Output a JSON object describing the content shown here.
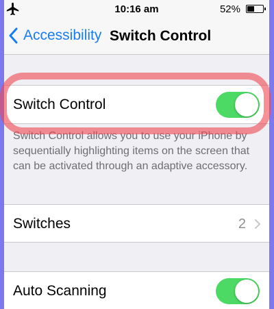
{
  "status_bar": {
    "airplane_icon": "airplane-icon",
    "time": "10:16 am",
    "battery_percent": "52%",
    "battery_level": 0.52
  },
  "nav": {
    "back_label": "Accessibility",
    "title": "Switch Control"
  },
  "switch_control": {
    "label": "Switch Control",
    "enabled": true,
    "footer": "Switch Control allows you to use your iPhone by sequentially highlighting items on the screen that can be activated through an adaptive accessory."
  },
  "switches": {
    "label": "Switches",
    "value": "2"
  },
  "auto_scanning": {
    "label": "Auto Scanning",
    "enabled": true
  },
  "colors": {
    "accent": "#1a7cf0",
    "toggle_on": "#4cd964",
    "highlight": "#f04650"
  }
}
